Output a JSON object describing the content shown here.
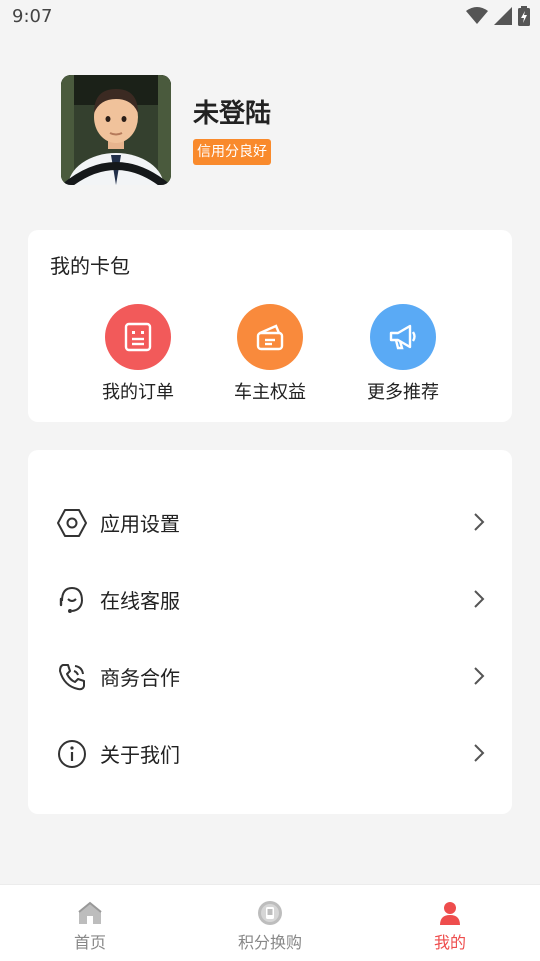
{
  "status_bar": {
    "time": "9:07"
  },
  "profile": {
    "name": "未登陆",
    "credit_badge": "信用分良好"
  },
  "wallet": {
    "title": "我的卡包",
    "items": [
      {
        "label": "我的订单",
        "icon": "order-icon",
        "color": "#f25a5a"
      },
      {
        "label": "车主权益",
        "icon": "wallet-icon",
        "color": "#f98a3c"
      },
      {
        "label": "更多推荐",
        "icon": "megaphone-icon",
        "color": "#5aaaf5"
      }
    ]
  },
  "menu": {
    "items": [
      {
        "label": "应用设置",
        "icon": "settings-hex-icon"
      },
      {
        "label": "在线客服",
        "icon": "customer-service-icon"
      },
      {
        "label": "商务合作",
        "icon": "phone-icon"
      },
      {
        "label": "关于我们",
        "icon": "info-icon"
      }
    ]
  },
  "tab_bar": {
    "tabs": [
      {
        "label": "首页",
        "icon": "home-icon",
        "active": false
      },
      {
        "label": "积分换购",
        "icon": "points-icon",
        "active": false
      },
      {
        "label": "我的",
        "icon": "user-icon",
        "active": true
      }
    ],
    "active_color": "#ee4d4d"
  }
}
